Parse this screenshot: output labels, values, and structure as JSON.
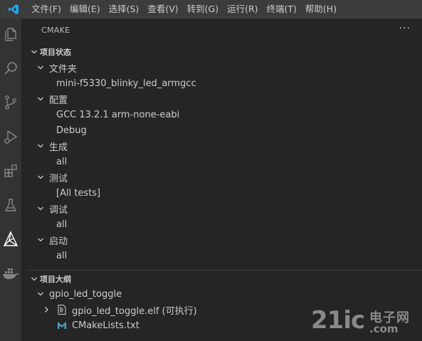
{
  "menu": [
    "文件(F)",
    "编辑(E)",
    "选择(S)",
    "查看(V)",
    "转到(G)",
    "运行(R)",
    "终端(T)",
    "帮助(H)"
  ],
  "colors": {
    "accent": "#007acc",
    "background": "#252526",
    "activity_bar": "#333333",
    "menubar": "#3c3c3c"
  },
  "activity_icons": [
    "explorer-icon",
    "search-icon",
    "source-control-icon",
    "run-debug-icon",
    "extensions-icon",
    "testing-icon",
    "cmake-icon",
    "docker-icon"
  ],
  "panel": {
    "title": "CMAKE",
    "more": "···"
  },
  "status": {
    "section_title": "项目状态",
    "groups": [
      {
        "label": "文件夹",
        "items": [
          "mini-f5330_blinky_led_armgcc"
        ]
      },
      {
        "label": "配置",
        "items": [
          "GCC 13.2.1 arm-none-eabi",
          "Debug"
        ]
      },
      {
        "label": "生成",
        "items": [
          "all"
        ]
      },
      {
        "label": "测试",
        "items": [
          "[All tests]"
        ]
      },
      {
        "label": "调试",
        "items": [
          "all"
        ]
      },
      {
        "label": "启动",
        "items": [
          "all"
        ]
      }
    ]
  },
  "outline": {
    "section_title": "项目大纲",
    "project": "gpio_led_toggle",
    "target": "gpio_led_toggle.elf (可执行)",
    "file": "CMakeLists.txt"
  },
  "watermark": {
    "logo": "21ic",
    "cn": "电子网",
    "com": ".com"
  }
}
